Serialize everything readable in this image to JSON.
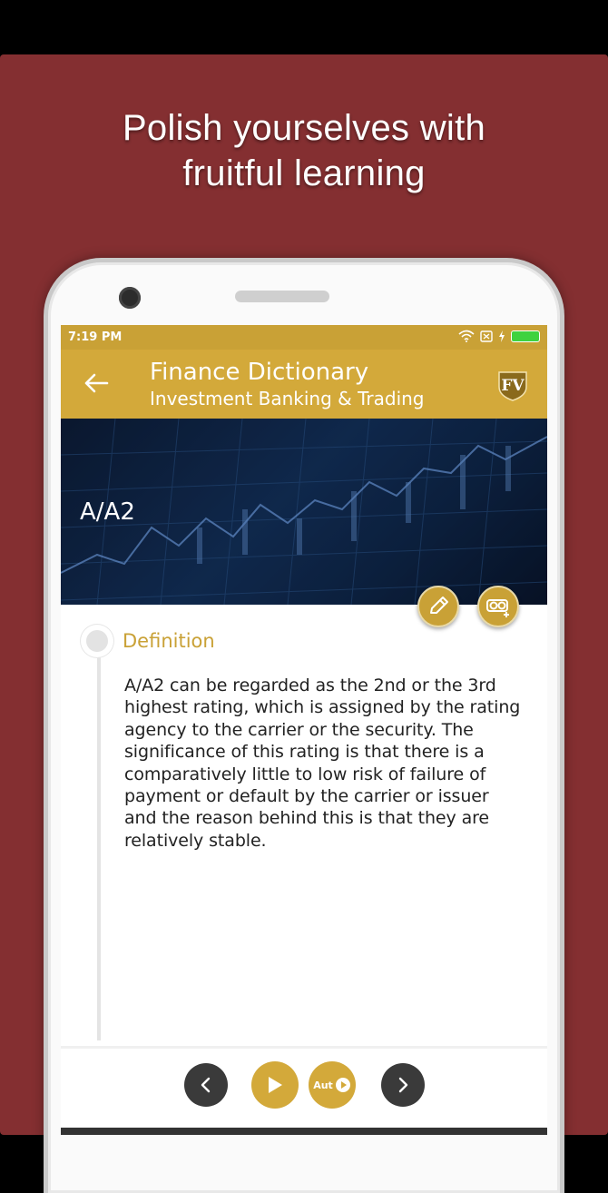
{
  "promo": {
    "headline_line1": "Polish yourselves with",
    "headline_line2": "fruitful learning",
    "background_color": "#842f31"
  },
  "status_bar": {
    "time": "7:19 PM",
    "icons": [
      "wifi-icon",
      "sim-icon",
      "charging-icon",
      "battery-icon"
    ]
  },
  "app_bar": {
    "title": "Finance Dictionary",
    "subtitle": "Investment Banking & Trading",
    "back_icon": "arrow-left-icon",
    "logo_text": "FV",
    "accent_color": "#d3a93a"
  },
  "term": {
    "name": "A/A2",
    "actions": [
      "edit-icon",
      "add-flashcard-icon"
    ]
  },
  "definition": {
    "label": "Definition",
    "text": "A/A2 can be regarded as the 2nd or the 3rd highest rating, which is assigned by the rating agency to the carrier or the security. The significance of this rating is that there is a comparatively little to low risk of failure of payment or default by the carrier or issuer and the reason behind this is that they are relatively stable."
  },
  "controls": {
    "previous_icon": "chevron-left-icon",
    "play_icon": "play-icon",
    "auto_label": "Aut",
    "next_icon": "chevron-right-icon"
  }
}
